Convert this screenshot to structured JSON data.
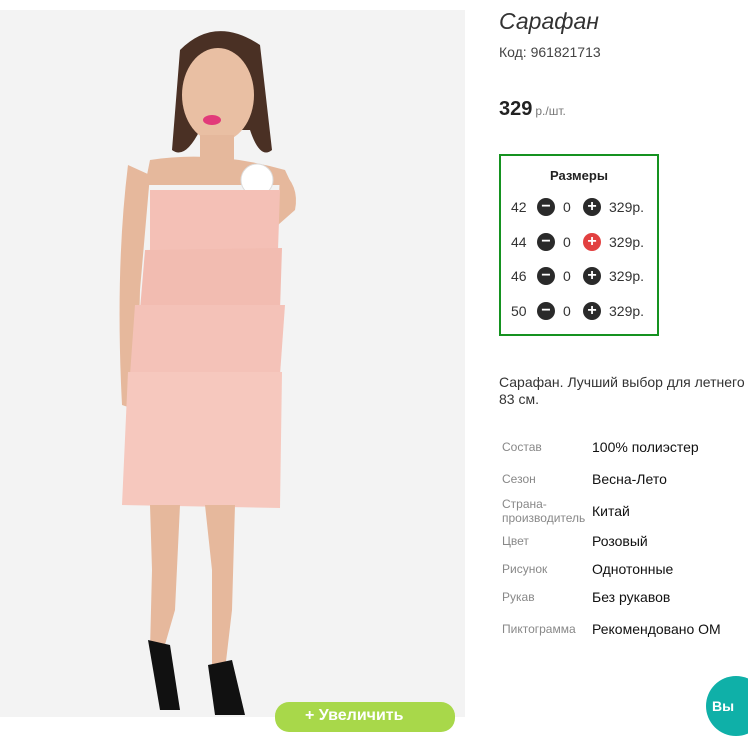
{
  "product": {
    "title": "Сарафан",
    "code": "Код: 961821713",
    "price": "329",
    "price_unit": "р./шт.",
    "add_to_cart_label": "+ Увеличить",
    "sizes_title": "Размеры",
    "sizes": [
      {
        "size": "42",
        "qty": "0",
        "price": "329р."
      },
      {
        "size": "44",
        "qty": "0",
        "price": "329р."
      },
      {
        "size": "46",
        "qty": "0",
        "price": "329р."
      },
      {
        "size": "50",
        "qty": "0",
        "price": "329р."
      }
    ],
    "description": "Сарафан. Лучший выбор для летнего 83 см.",
    "properties": [
      {
        "key": "Состав",
        "value": "100% полиэстер"
      },
      {
        "key": "Сезон",
        "value": "Весна-Лето"
      },
      {
        "key": "Страна-производитель",
        "value": "Китай"
      },
      {
        "key": "Цвет",
        "value": "Розовый"
      },
      {
        "key": "Рисунок",
        "value": "Однотонные"
      },
      {
        "key": "Рукав",
        "value": "Без рукавов"
      },
      {
        "key": "Пиктограмма",
        "value": "Рекомендовано ОМ"
      }
    ]
  },
  "chat_button_label": "Вы",
  "colors": {
    "accent_green": "#159220",
    "cart_green": "#a8d84a",
    "teal": "#0fb0a8",
    "plus_red": "#e24040"
  }
}
